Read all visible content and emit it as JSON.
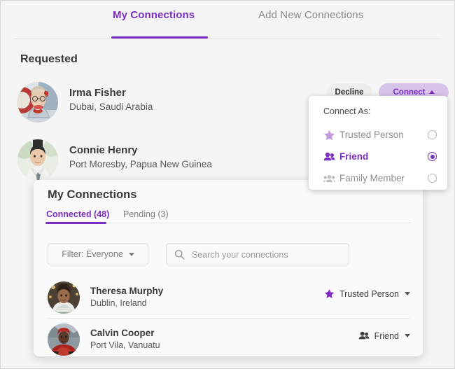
{
  "tabs": {
    "my_connections": "My Connections",
    "add_new_connections": "Add New Connections",
    "active": "My Connections"
  },
  "requested": {
    "heading": "Requested",
    "people": [
      {
        "name": "Irma Fisher",
        "location": "Dubai, Saudi Arabia"
      },
      {
        "name": "Connie Henry",
        "location": "Port Moresby, Papua New Guinea"
      }
    ],
    "actions": {
      "decline_label": "Decline",
      "connect_label": "Connect",
      "connect_caret": "chevron-up-icon"
    }
  },
  "connect_dropdown": {
    "label": "Connect As:",
    "options": [
      {
        "label": "Trusted Person",
        "icon": "star-icon",
        "selected": false
      },
      {
        "label": "Friend",
        "icon": "two-people-icon",
        "selected": true
      },
      {
        "label": "Family Member",
        "icon": "three-people-icon",
        "selected": false
      }
    ]
  },
  "modal": {
    "title": "My Connections",
    "tabs": [
      {
        "label": "Connected (48)",
        "active": true
      },
      {
        "label": "Pending (3)",
        "active": false
      }
    ],
    "filter": {
      "label": "Filter: Everyone",
      "caret": "chevron-down-icon"
    },
    "search": {
      "placeholder": "Search your connections",
      "value": "",
      "icon": "search-icon"
    },
    "connections": [
      {
        "name": "Theresa Murphy",
        "location": "Dublin, Ireland",
        "badge_label": "Trusted Person",
        "badge_icon": "star-icon"
      },
      {
        "name": "Calvin Cooper",
        "location": "Port Vila, Vanuatu",
        "badge_label": "Friend",
        "badge_icon": "two-people-icon"
      }
    ]
  },
  "colors": {
    "accent_purple": "#7a2fc2",
    "connect_button_bg": "#d8c4ea",
    "page_background": "#f5f5f5",
    "modal_background": "#fafafa",
    "muted_text": "#8b8b8b"
  }
}
